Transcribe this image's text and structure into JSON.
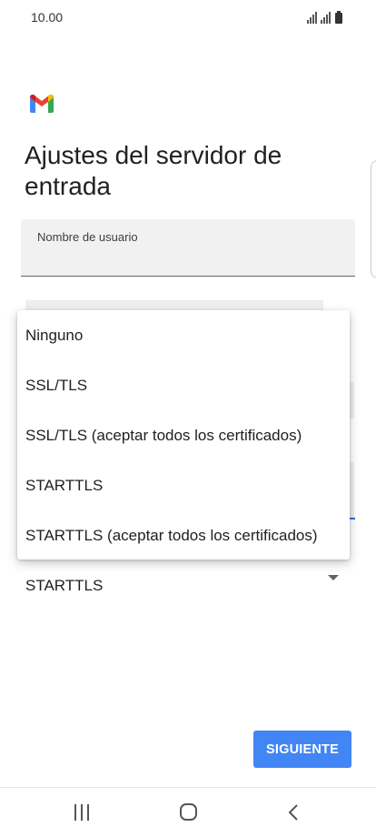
{
  "status_bar": {
    "time": "10.00",
    "icons": [
      "signal-icon",
      "signal-icon",
      "battery-icon"
    ]
  },
  "app": {
    "logo": "gmail-logo"
  },
  "page": {
    "title": "Ajustes del servidor de entrada"
  },
  "form": {
    "username_label": "Nombre de usuario",
    "security_type_value": "STARTTLS"
  },
  "dropdown": {
    "options": [
      "Ninguno",
      "SSL/TLS",
      "SSL/TLS (aceptar todos los certificados)",
      "STARTTLS",
      "STARTTLS (aceptar todos los certificados)"
    ]
  },
  "actions": {
    "next_label": "SIGUIENTE"
  },
  "colors": {
    "accent": "#4285f4",
    "field_background": "#f1f1f1",
    "focus_underline": "#1a73e8"
  },
  "nav_bar": {
    "icons": [
      "recents-icon",
      "home-icon",
      "back-icon"
    ]
  }
}
